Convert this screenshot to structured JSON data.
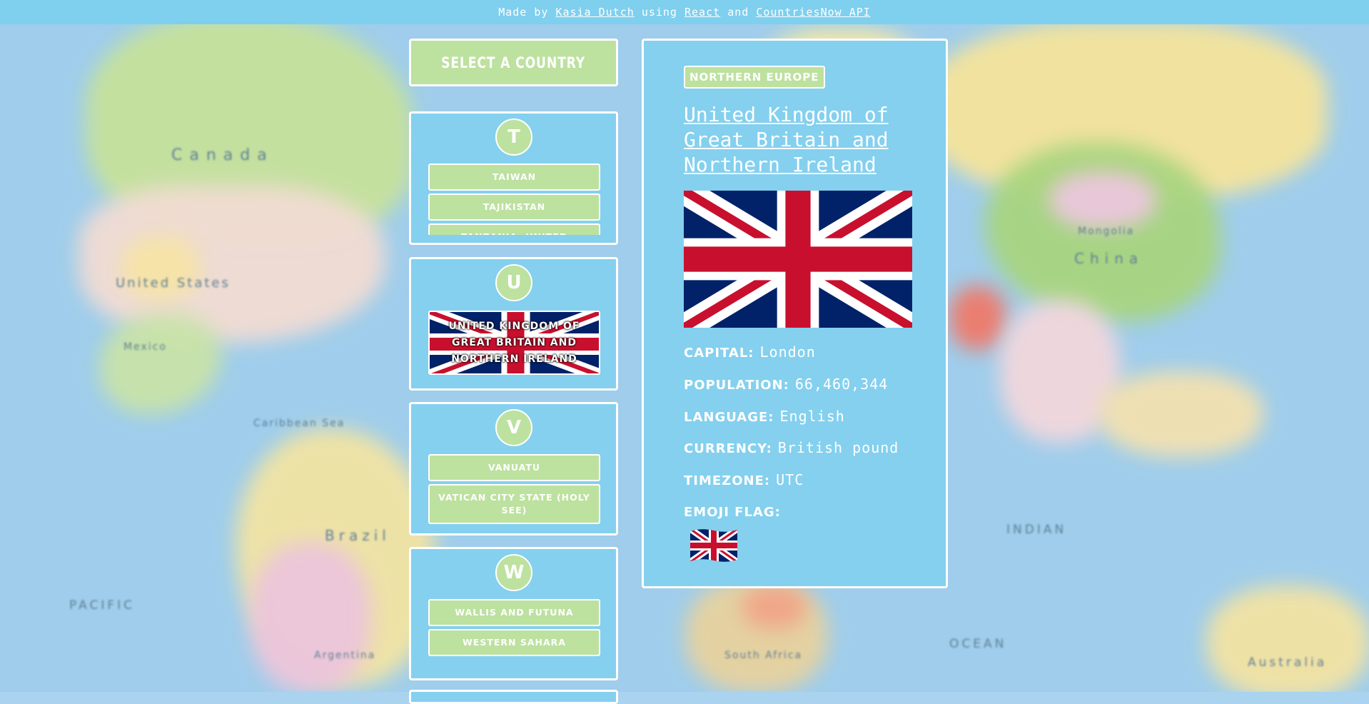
{
  "header": {
    "prefix": "Made by",
    "author_link": "Kasia Dutch",
    "middle": "using",
    "react_link": "React",
    "and_text": "and",
    "api_link": "CountriesNow API"
  },
  "selector": {
    "title": "SELECT A COUNTRY"
  },
  "groups": [
    {
      "letter": "T",
      "countries": [
        "Taiwan",
        "Tajikistan",
        "Tanzania, United Republic"
      ]
    },
    {
      "letter": "U",
      "countries": [
        "United Kingdom of Great Britain and Northern Ireland"
      ]
    },
    {
      "letter": "V",
      "countries": [
        "Vanuatu",
        "Vatican City State (Holy See)"
      ]
    },
    {
      "letter": "W",
      "countries": [
        "Wallis and Futuna",
        "Western Sahara"
      ]
    }
  ],
  "detail": {
    "region": "NORTHERN EUROPE",
    "name": "United Kingdom of Great Britain and Northern Ireland",
    "capital_label": "CAPITAL:",
    "capital": "London",
    "population_label": "POPULATION:",
    "population": "66,460,344",
    "language_label": "LANGUAGE:",
    "language": "English",
    "currency_label": "CURRENCY:",
    "currency": "British pound",
    "timezone_label": "TIMEZONE:",
    "timezone": "UTC",
    "emoji_label": "EMOJI FLAG:"
  },
  "map_labels": {
    "canada": "Canada",
    "usa": "United States",
    "brazil": "Brazil",
    "china": "China",
    "pacific": "PACIFIC",
    "indian": "INDIAN",
    "ocean": "OCEAN",
    "australia": "Australia",
    "mongolia": "Mongolia",
    "mexico": "Mexico",
    "argentina": "Argentina",
    "caribbean": "Caribbean Sea",
    "south_africa": "South Africa"
  },
  "colors": {
    "panel": "#84d0ee",
    "topbar": "#7fcfee",
    "green": "#bde19f",
    "flag_blue": "#012169",
    "flag_red": "#c8102e"
  }
}
